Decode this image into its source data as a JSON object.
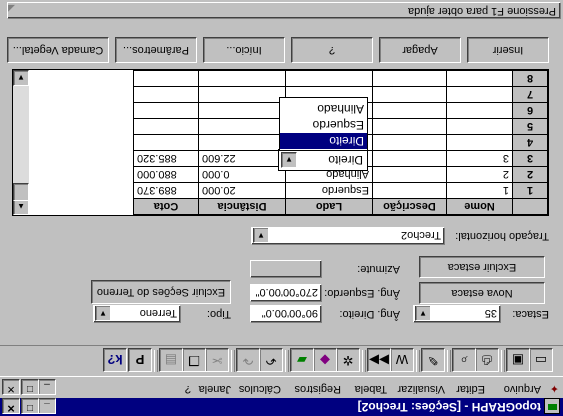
{
  "window": {
    "title": "topoGRAPH - [Seções: Trecho2]",
    "minimize_glyph": "_",
    "maximize_glyph": "□",
    "close_glyph": "✕"
  },
  "menu": {
    "items": [
      "Arquivo",
      "Editar",
      "Visualizar",
      "Tabela",
      "Registros",
      "Cálculos",
      "Janela",
      "?"
    ]
  },
  "toolbar": {
    "icons": [
      "new-icon",
      "save-icon",
      "print-icon",
      "print-preview-icon",
      "pencil-icon",
      "zoom-window-icon",
      "forward-icon",
      "points-icon",
      "layers-icon",
      "colors-icon",
      "undo-icon",
      "redo-icon",
      "cut-icon",
      "copy-icon",
      "paste-icon",
      "properties-icon",
      "help-icon"
    ]
  },
  "form": {
    "estaca_label": "Estaca:",
    "estaca_value": "35",
    "nova_estaca_label": "Nova estaca",
    "excluir_estaca_label": "Excluir estaca",
    "ang_direito_label": "Âng. Direito:",
    "ang_direito_value": "90°00'00.0\"",
    "ang_esquerdo_label": "Âng. Esquerdo:",
    "ang_esquerdo_value": "270°00'00.0\"",
    "azimute_label": "Azimute:",
    "azimute_value": "",
    "tipo_label": "Tipo:",
    "tipo_value": "Terreno",
    "excluir_secoes_label": "Excluir Seções do Terreno",
    "tracado_label": "Traçado horizontal:",
    "tracado_value": "Trecho2"
  },
  "grid": {
    "columns": [
      "",
      "Nome",
      "Descrição",
      "Lado",
      "Distância",
      "Cota"
    ],
    "rows": [
      {
        "n": "1",
        "nome": "1",
        "descricao": "",
        "lado": "Esquerdo",
        "distancia": "20.000",
        "cota": "889.370"
      },
      {
        "n": "2",
        "nome": "2",
        "descricao": "",
        "lado": "Alinhado",
        "distancia": "0.000",
        "cota": "880.000"
      },
      {
        "n": "3",
        "nome": "3",
        "descricao": "",
        "lado": "Direito",
        "distancia": "22.600",
        "cota": "885.320"
      },
      {
        "n": "4",
        "nome": "",
        "descricao": "",
        "lado": "",
        "distancia": "",
        "cota": ""
      },
      {
        "n": "5",
        "nome": "",
        "descricao": "",
        "lado": "",
        "distancia": "",
        "cota": ""
      },
      {
        "n": "6",
        "nome": "",
        "descricao": "",
        "lado": "",
        "distancia": "",
        "cota": ""
      },
      {
        "n": "7",
        "nome": "",
        "descricao": "",
        "lado": "",
        "distancia": "",
        "cota": ""
      },
      {
        "n": "8",
        "nome": "",
        "descricao": "",
        "lado": "",
        "distancia": "",
        "cota": ""
      }
    ],
    "lado_dropdown": {
      "options": [
        "Direito",
        "Esquerdo",
        "Alinhado"
      ],
      "selected": "Direito"
    }
  },
  "buttons": {
    "inserir": "Inserir",
    "apagar": "Apagar",
    "help": "?",
    "inicio": "Início...",
    "parametros": "Parâmetros...",
    "camada": "Camada Vegetal..."
  },
  "status": {
    "text": "Pressione F1 para obter ajuda"
  }
}
